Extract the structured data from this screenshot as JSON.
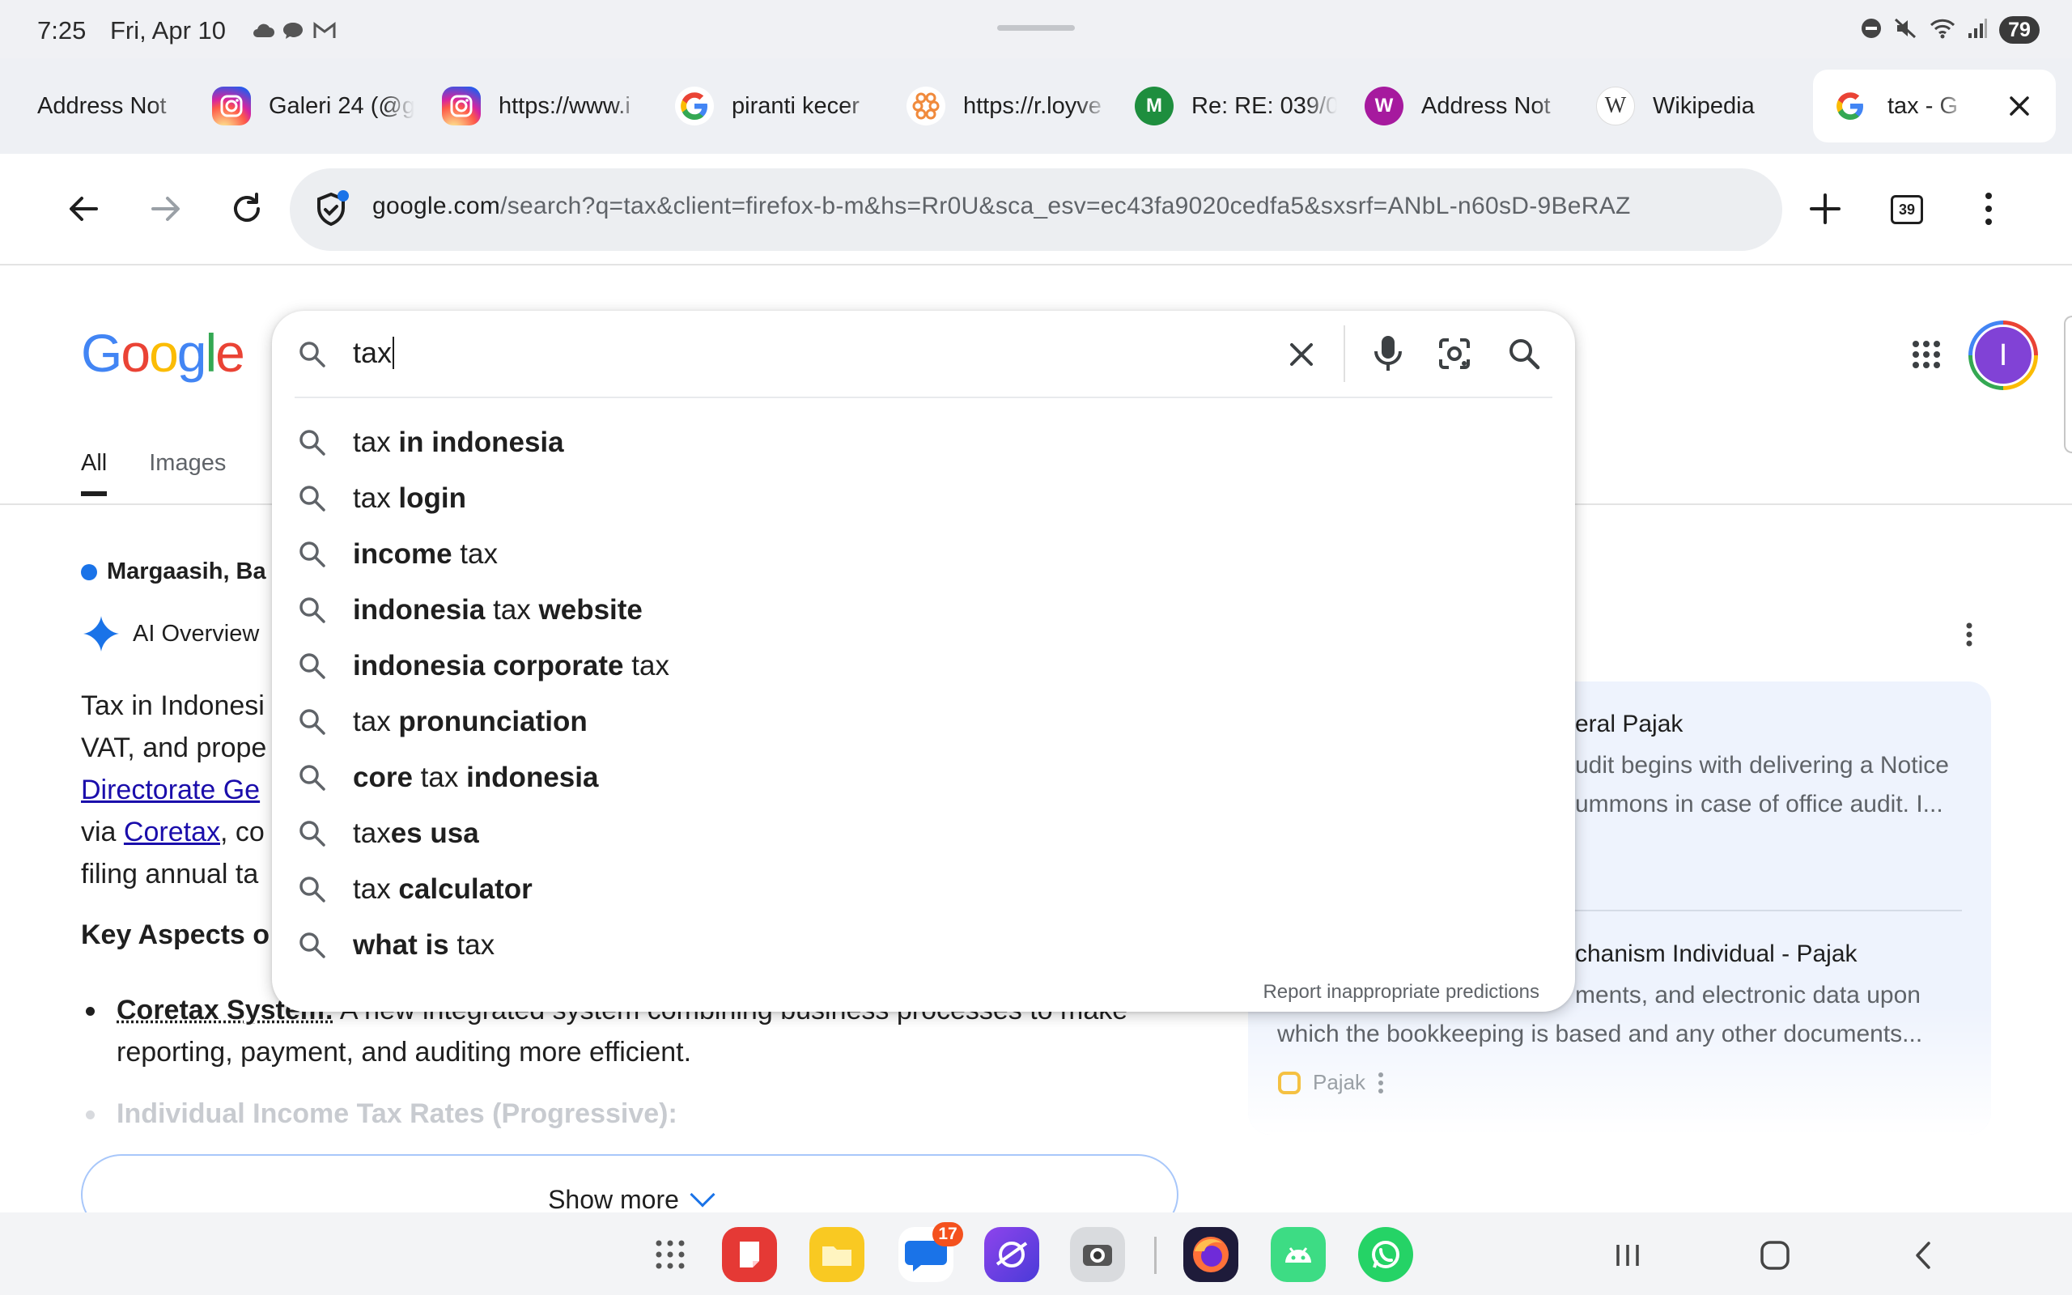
{
  "status_bar": {
    "time": "7:25",
    "date": "Fri, Apr 10",
    "battery": "79"
  },
  "tabs": [
    {
      "label": "Address Not",
      "favicon": "none"
    },
    {
      "label": "Galeri 24 (@g",
      "favicon": "instagram-icon"
    },
    {
      "label": "https://www.i",
      "favicon": "instagram-icon"
    },
    {
      "label": "piranti kecer",
      "favicon": "google-icon"
    },
    {
      "label": "https://r.loyve",
      "favicon": "loyverse-icon"
    },
    {
      "label": "Re: RE: 039/0",
      "favicon": "letter-icon",
      "letter": "M",
      "color": "#1e8e3e"
    },
    {
      "label": "Address Not",
      "favicon": "letter-icon",
      "letter": "W",
      "color": "#a61a9e"
    },
    {
      "label": "Wikipedia",
      "favicon": "wikipedia-icon",
      "letter": "W"
    },
    {
      "label": "tax - G",
      "favicon": "google-icon",
      "active": true
    }
  ],
  "toolbar": {
    "url_host": "google.com",
    "url_path": "/search?q=tax&client=firefox-b-m&hs=Rr0U&sca_esv=ec43fa9020cedfa5&sxsrf=ANbL-n60sD-9BeRAZ",
    "tab_count": "39"
  },
  "google": {
    "logo": [
      "G",
      "o",
      "o",
      "g",
      "l",
      "e"
    ],
    "nav_tabs": [
      "All",
      "Images"
    ],
    "location": "Margaasih, Ba",
    "ai_overview_label": "AI Overview",
    "aio_lines": [
      {
        "text": "Tax in Indonesi",
        "link": false
      },
      {
        "text": "VAT, and prope",
        "link": false
      },
      {
        "text": "Directorate Ge",
        "link": true
      },
      {
        "prefix": "via ",
        "link_text": "Coretax",
        "suffix": ", co"
      },
      {
        "text": "filing annual ta",
        "link": false
      }
    ],
    "key_aspects": "Key Aspects o",
    "bullets": [
      {
        "title": "Coretax System:",
        "body": " A new integrated system combining business processes to make reporting, payment, and auditing more efficient."
      },
      {
        "title": "Individual Income Tax Rates (Progressive):",
        "body": "",
        "faded": true
      }
    ],
    "show_more": "Show more",
    "sources": [
      {
        "title": "eral Pajak",
        "snippet": [
          "udit begins with delivering a Notice",
          "ummons in case of office audit. I..."
        ]
      },
      {
        "title": "chanism Individual - Pajak",
        "snippet": [
          "ments, and electronic data upon",
          "which the bookkeeping is based and any other documents..."
        ],
        "site": "Pajak"
      }
    ]
  },
  "search": {
    "query": "tax",
    "suggestions": [
      [
        {
          "t": "tax ",
          "b": false
        },
        {
          "t": "in indonesia",
          "b": true
        }
      ],
      [
        {
          "t": "tax ",
          "b": false
        },
        {
          "t": "login",
          "b": true
        }
      ],
      [
        {
          "t": "income ",
          "b": true
        },
        {
          "t": "tax",
          "b": false
        }
      ],
      [
        {
          "t": "indonesia ",
          "b": true
        },
        {
          "t": "tax ",
          "b": false
        },
        {
          "t": "website",
          "b": true
        }
      ],
      [
        {
          "t": "indonesia corporate ",
          "b": true
        },
        {
          "t": "tax",
          "b": false
        }
      ],
      [
        {
          "t": "tax ",
          "b": false
        },
        {
          "t": "pronunciation",
          "b": true
        }
      ],
      [
        {
          "t": "core ",
          "b": true
        },
        {
          "t": "tax ",
          "b": false
        },
        {
          "t": "indonesia",
          "b": true
        }
      ],
      [
        {
          "t": "tax",
          "b": false
        },
        {
          "t": "es usa",
          "b": true
        }
      ],
      [
        {
          "t": "tax ",
          "b": false
        },
        {
          "t": "calculator",
          "b": true
        }
      ],
      [
        {
          "t": "what is ",
          "b": true
        },
        {
          "t": "tax",
          "b": false
        }
      ]
    ],
    "report_text": "Report inappropriate predictions"
  },
  "dock": {
    "messages_badge": "17",
    "apps": [
      "apps-grid-icon",
      "notes-icon",
      "files-icon",
      "messages-icon",
      "internet-icon",
      "camera-icon",
      "firefox-icon",
      "android-icon",
      "whatsapp-icon"
    ]
  }
}
